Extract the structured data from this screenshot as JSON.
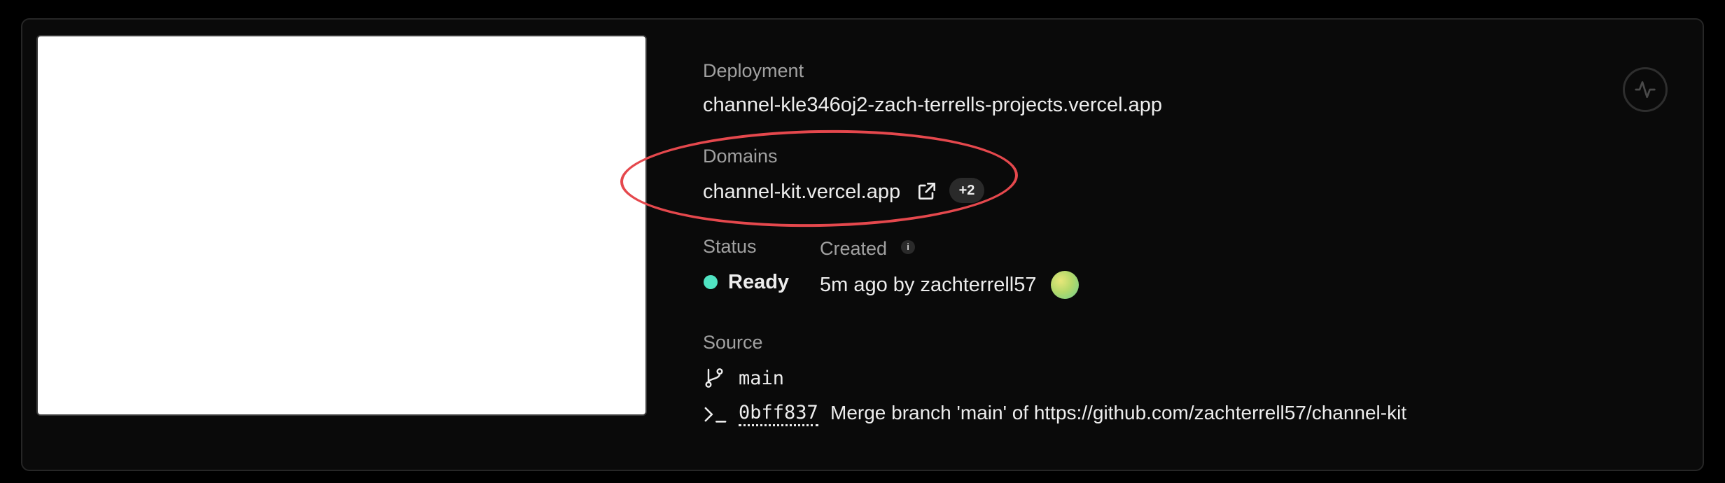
{
  "deployment": {
    "label": "Deployment",
    "url": "channel-kle346oj2-zach-terrells-projects.vercel.app"
  },
  "domains": {
    "label": "Domains",
    "primary": "channel-kit.vercel.app",
    "extra_count": "+2"
  },
  "status": {
    "label": "Status",
    "value": "Ready",
    "color": "#50e3c2"
  },
  "created": {
    "label": "Created",
    "info_icon": "i",
    "value": "5m ago by zachterrell57"
  },
  "source": {
    "label": "Source",
    "branch": "main",
    "commit_hash": "0bff837",
    "commit_message": "Merge branch 'main' of https://github.com/zachterrell57/channel-kit"
  },
  "icons": {
    "external_link": "external-link-icon",
    "branch": "git-branch-icon",
    "commit": "terminal-prompt-icon",
    "activity": "activity-pulse-icon"
  },
  "colors": {
    "annotation": "#e5484d",
    "background": "#0a0a0a"
  }
}
